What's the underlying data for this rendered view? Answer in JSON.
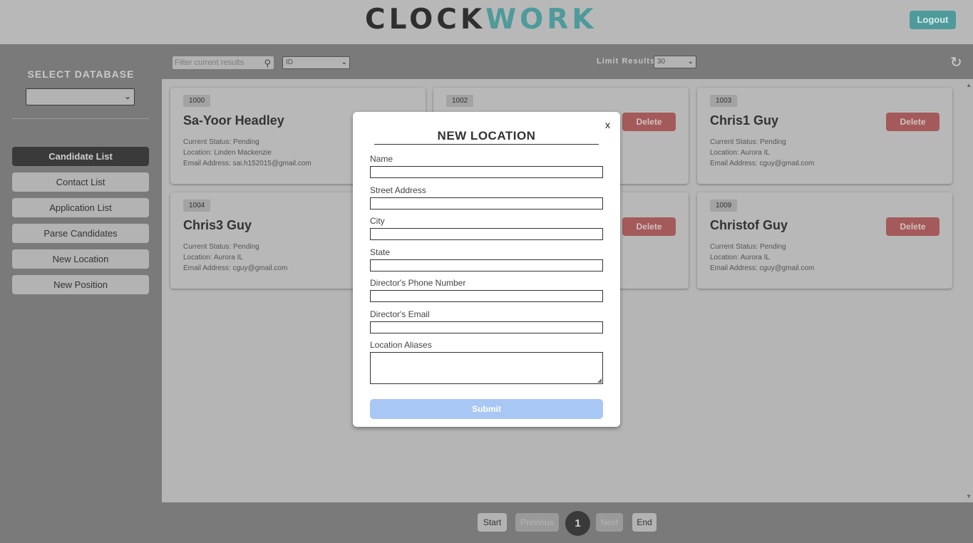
{
  "header": {
    "logo_part1": "CLOCK",
    "logo_part2": "WORK",
    "logout_label": "Logout"
  },
  "sidebar": {
    "title": "SELECT DATABASE",
    "database_value": "",
    "items": [
      {
        "label": "Candidate List",
        "active": true
      },
      {
        "label": "Contact List"
      },
      {
        "label": "Application List"
      },
      {
        "label": "Parse Candidates"
      },
      {
        "label": "New Location"
      },
      {
        "label": "New Position"
      }
    ]
  },
  "toolbar": {
    "filter_placeholder": "Filter current results",
    "sort_value": "ID",
    "limit_label": "Limit Results",
    "limit_value": "30"
  },
  "cards": [
    {
      "id": "1000",
      "name": "Sa-Yoor Headley",
      "status": "Current Status: Pending",
      "location": "Location: Linden Mackenzie",
      "email": "Email Address: sai.h152015@gmail.com",
      "delete_label": "Delete"
    },
    {
      "id": "1002",
      "name": "",
      "status": "",
      "location": "",
      "email": "",
      "delete_label": "Delete"
    },
    {
      "id": "1003",
      "name": "Chris1 Guy",
      "status": "Current Status: Pending",
      "location": "Location: Aurora IL",
      "email": "Email Address: cguy@gmail.com",
      "delete_label": "Delete"
    },
    {
      "id": "1004",
      "name": "Chris3 Guy",
      "status": "Current Status: Pending",
      "location": "Location: Aurora IL",
      "email": "Email Address: cguy@gmail.com",
      "delete_label": "Delete"
    },
    {
      "id": "",
      "name": "",
      "status": "",
      "location": "",
      "email": "",
      "delete_label": "Delete"
    },
    {
      "id": "1009",
      "name": "Christof Guy",
      "status": "Current Status: Pending",
      "location": "Location: Aurora IL",
      "email": "Email Address: cguy@gmail.com",
      "delete_label": "Delete"
    }
  ],
  "pagination": {
    "start": "Start",
    "previous": "Previous",
    "current": "1",
    "next": "Next",
    "end": "End"
  },
  "modal": {
    "close": "x",
    "title": "NEW LOCATION",
    "fields": [
      {
        "label": "Name",
        "value": ""
      },
      {
        "label": "Street Address",
        "value": ""
      },
      {
        "label": "City",
        "value": ""
      },
      {
        "label": "State",
        "value": ""
      },
      {
        "label": "Director's Phone Number",
        "value": ""
      },
      {
        "label": "Director's Email",
        "value": ""
      }
    ],
    "aliases_label": "Location Aliases",
    "aliases_value": "",
    "submit_label": "Submit"
  },
  "colors": {
    "accent": "#4f9a9a",
    "delete": "#a45a5a",
    "submit": "#a9c7f5"
  }
}
